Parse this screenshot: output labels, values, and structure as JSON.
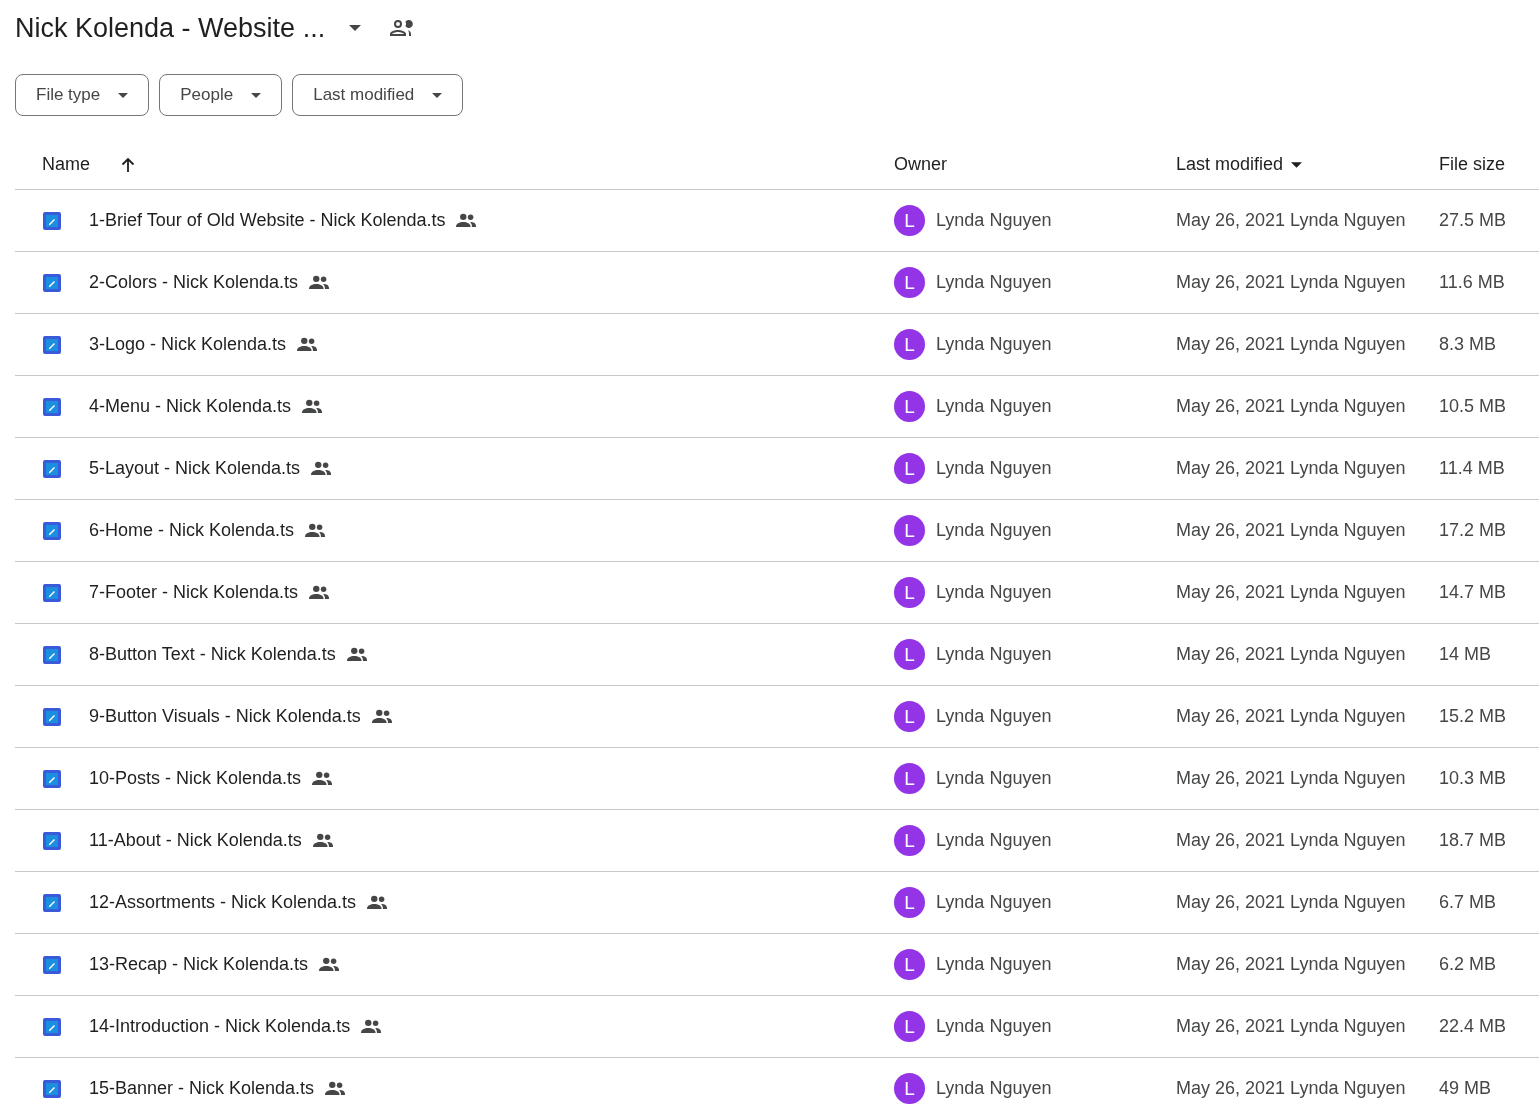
{
  "folder": {
    "title": "Nick Kolenda - Website ...",
    "shared": true
  },
  "filters": [
    {
      "label": "File type"
    },
    {
      "label": "People"
    },
    {
      "label": "Last modified"
    }
  ],
  "table": {
    "columns": [
      {
        "label": "Name",
        "sorted": true,
        "descending": false
      },
      {
        "label": "Owner",
        "sorted": false
      },
      {
        "label": "Last modified",
        "sorted": true,
        "descending": true
      },
      {
        "label": "File size",
        "sorted": false
      }
    ],
    "rows": [
      {
        "name": "1-Brief Tour of Old Website - Nick Kolenda.ts",
        "shared": true,
        "owner": "Lynda Nguyen",
        "avatar": "L",
        "color": "#9334e6",
        "modified": "May 26, 2021 Lynda Nguyen",
        "size": "27.5 MB"
      },
      {
        "name": "2-Colors - Nick Kolenda.ts",
        "shared": true,
        "owner": "Lynda Nguyen",
        "avatar": "L",
        "color": "#9334e6",
        "modified": "May 26, 2021 Lynda Nguyen",
        "size": "11.6 MB"
      },
      {
        "name": "3-Logo - Nick Kolenda.ts",
        "shared": true,
        "owner": "Lynda Nguyen",
        "avatar": "L",
        "color": "#9334e6",
        "modified": "May 26, 2021 Lynda Nguyen",
        "size": "8.3 MB"
      },
      {
        "name": "4-Menu - Nick Kolenda.ts",
        "shared": true,
        "owner": "Lynda Nguyen",
        "avatar": "L",
        "color": "#9334e6",
        "modified": "May 26, 2021 Lynda Nguyen",
        "size": "10.5 MB"
      },
      {
        "name": "5-Layout - Nick Kolenda.ts",
        "shared": true,
        "owner": "Lynda Nguyen",
        "avatar": "L",
        "color": "#9334e6",
        "modified": "May 26, 2021 Lynda Nguyen",
        "size": "11.4 MB"
      },
      {
        "name": "6-Home - Nick Kolenda.ts",
        "shared": true,
        "owner": "Lynda Nguyen",
        "avatar": "L",
        "color": "#9334e6",
        "modified": "May 26, 2021 Lynda Nguyen",
        "size": "17.2 MB"
      },
      {
        "name": "7-Footer - Nick Kolenda.ts",
        "shared": true,
        "owner": "Lynda Nguyen",
        "avatar": "L",
        "color": "#9334e6",
        "modified": "May 26, 2021 Lynda Nguyen",
        "size": "14.7 MB"
      },
      {
        "name": "8-Button Text - Nick Kolenda.ts",
        "shared": true,
        "owner": "Lynda Nguyen",
        "avatar": "L",
        "color": "#9334e6",
        "modified": "May 26, 2021 Lynda Nguyen",
        "size": "14 MB"
      },
      {
        "name": "9-Button Visuals - Nick Kolenda.ts",
        "shared": true,
        "owner": "Lynda Nguyen",
        "avatar": "L",
        "color": "#9334e6",
        "modified": "May 26, 2021 Lynda Nguyen",
        "size": "15.2 MB"
      },
      {
        "name": "10-Posts - Nick Kolenda.ts",
        "shared": true,
        "owner": "Lynda Nguyen",
        "avatar": "L",
        "color": "#9334e6",
        "modified": "May 26, 2021 Lynda Nguyen",
        "size": "10.3 MB"
      },
      {
        "name": "11-About - Nick Kolenda.ts",
        "shared": true,
        "owner": "Lynda Nguyen",
        "avatar": "L",
        "color": "#9334e6",
        "modified": "May 26, 2021 Lynda Nguyen",
        "size": "18.7 MB"
      },
      {
        "name": "12-Assortments - Nick Kolenda.ts",
        "shared": true,
        "owner": "Lynda Nguyen",
        "avatar": "L",
        "color": "#9334e6",
        "modified": "May 26, 2021 Lynda Nguyen",
        "size": "6.7 MB"
      },
      {
        "name": "13-Recap - Nick Kolenda.ts",
        "shared": true,
        "owner": "Lynda Nguyen",
        "avatar": "L",
        "color": "#9334e6",
        "modified": "May 26, 2021 Lynda Nguyen",
        "size": "6.2 MB"
      },
      {
        "name": "14-Introduction - Nick Kolenda.ts",
        "shared": true,
        "owner": "Lynda Nguyen",
        "avatar": "L",
        "color": "#9334e6",
        "modified": "May 26, 2021 Lynda Nguyen",
        "size": "22.4 MB"
      },
      {
        "name": "15-Banner - Nick Kolenda.ts",
        "shared": true,
        "owner": "Lynda Nguyen",
        "avatar": "L",
        "color": "#9334e6",
        "modified": "May 26, 2021 Lynda Nguyen",
        "size": "49 MB"
      }
    ]
  }
}
